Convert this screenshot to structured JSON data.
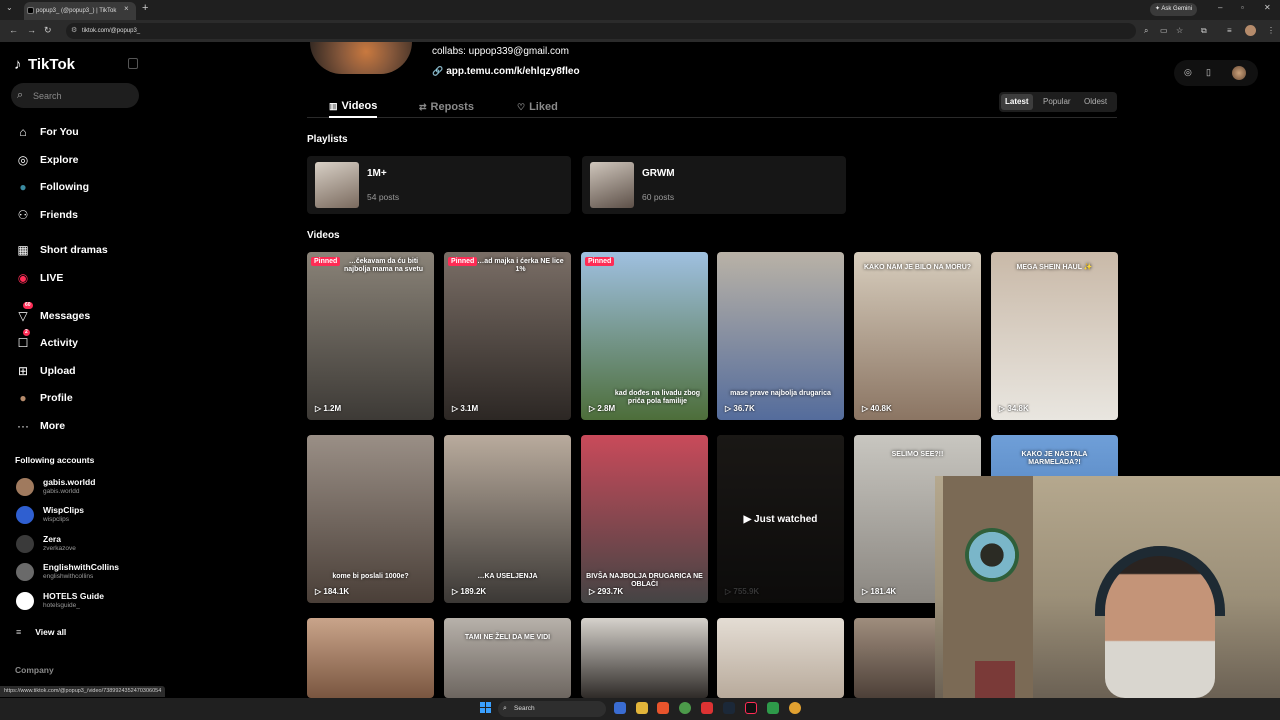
{
  "browser": {
    "tab_title": "popup3_ (@popup3_) | TikTok",
    "tab_close": "×",
    "new_tab": "+",
    "tabs_menu": "⌄",
    "url": "tiktok.com/@popup3_",
    "ask_gemini": "Ask Gemini",
    "status_url": "https://www.tiktok.com/@popup3_/video/7389924352470306054"
  },
  "sidebar": {
    "logo": "TikTok",
    "search_placeholder": "Search",
    "nav": [
      {
        "label": "For You",
        "icon": "home-icon"
      },
      {
        "label": "Explore",
        "icon": "compass-icon"
      },
      {
        "label": "Following",
        "icon": "following-avatar-icon"
      },
      {
        "label": "Friends",
        "icon": "friends-icon"
      },
      {
        "label": "Short dramas",
        "icon": "film-icon"
      },
      {
        "label": "LIVE",
        "icon": "live-icon"
      },
      {
        "label": "Messages",
        "icon": "messages-icon",
        "badge": "60"
      },
      {
        "label": "Activity",
        "icon": "activity-icon",
        "badge": "2"
      },
      {
        "label": "Upload",
        "icon": "upload-icon"
      },
      {
        "label": "Profile",
        "icon": "profile-avatar-icon"
      },
      {
        "label": "More",
        "icon": "more-icon"
      }
    ],
    "following_title": "Following accounts",
    "accounts": [
      {
        "name": "gabis.worldd",
        "handle": "gabis.worldd",
        "color": "#a07a5e"
      },
      {
        "name": "WispClips",
        "handle": "wispclips",
        "color": "#2f5fd0"
      },
      {
        "name": "Zera",
        "handle": "zverkazove",
        "color": "#3a3a3a"
      },
      {
        "name": "EnglishwithCollins",
        "handle": "englishwithcollins",
        "color": "#6a6a6a"
      },
      {
        "name": "HOTELS Guide",
        "handle": "hotelsguide_",
        "color": "#ffffff"
      }
    ],
    "view_all": "View all",
    "company": "Company"
  },
  "profile": {
    "collabs": "collabs: uppop339@gmail.com",
    "link": "app.temu.com/k/ehlqzy8fleo",
    "tabs": [
      {
        "label": "Videos",
        "active": true
      },
      {
        "label": "Reposts",
        "active": false
      },
      {
        "label": "Liked",
        "active": false
      }
    ],
    "sort": [
      "Latest",
      "Popular",
      "Oldest"
    ],
    "sort_selected": "Latest"
  },
  "playlists_heading": "Playlists",
  "playlists": [
    {
      "name": "1M+",
      "count": "54 posts"
    },
    {
      "name": "GRWM",
      "count": "60 posts"
    }
  ],
  "videos_heading": "Videos",
  "pinned_label": "Pinned",
  "just_watched": "Just watched",
  "videos": [
    {
      "views": "1.2M",
      "pinned": true,
      "caption": "…čekavam da ću biti najbolja mama na svetu",
      "colors": [
        "#8a8378",
        "#3d3a36"
      ]
    },
    {
      "views": "3.1M",
      "pinned": true,
      "caption": "…ad majka i ćerka NE lice 1%",
      "colors": [
        "#7a6e66",
        "#2c2724"
      ]
    },
    {
      "views": "2.8M",
      "pinned": true,
      "caption": "kad dođes na livadu zbog priča pola familije",
      "colors": [
        "#9fc0e0",
        "#4d6e3a"
      ]
    },
    {
      "views": "36.7K",
      "pinned": false,
      "caption": "mase prave najbolja drugarica",
      "colors": [
        "#b9b2a6",
        "#546c9c"
      ]
    },
    {
      "views": "40.8K",
      "pinned": false,
      "caption": "KAKO NAM JE BILO NA MORU?",
      "colors": [
        "#d7cdbd",
        "#8b7563"
      ]
    },
    {
      "views": "34.8K",
      "pinned": false,
      "caption": "MEGA SHEIN HAUL ✨",
      "colors": [
        "#c9b9a8",
        "#e9e6e0"
      ]
    },
    {
      "views": "184.1K",
      "pinned": false,
      "caption": "kome bi poslali 1000e?",
      "colors": [
        "#9a8f86",
        "#4a3f38"
      ]
    },
    {
      "views": "189.2K",
      "pinned": false,
      "caption": "…KA USELJENJA",
      "colors": [
        "#b9ab9d",
        "#3b3835"
      ]
    },
    {
      "views": "293.7K",
      "pinned": false,
      "caption": "BIVŠA NAJBOLJA DRUGARICA NE OBLAČI",
      "colors": [
        "#c94a5a",
        "#444"
      ]
    },
    {
      "views": "755.9K",
      "pinned": false,
      "caption": "",
      "colors": [
        "#3a3530",
        "#1c1a18"
      ],
      "just_watched": true
    },
    {
      "views": "181.4K",
      "pinned": false,
      "caption": "SELIMO SEE?!!",
      "colors": [
        "#c8c6c0",
        "#8a8680"
      ]
    },
    {
      "views": "",
      "pinned": false,
      "caption": "KAKO JE NASTALA MARMELADA?!",
      "colors": [
        "#6f9fd8",
        "#3b6aa8"
      ]
    },
    {
      "views": "",
      "pinned": false,
      "caption": "",
      "colors": [
        "#c9a48a",
        "#7a5640"
      ]
    },
    {
      "views": "",
      "pinned": false,
      "caption": "TAMI NE ŽELI DA ME VIDI",
      "colors": [
        "#b7b1aa",
        "#6d6660"
      ]
    },
    {
      "views": "",
      "pinned": false,
      "caption": "",
      "colors": [
        "#d6d2cc",
        "#2f2b28"
      ]
    },
    {
      "views": "",
      "pinned": false,
      "caption": "",
      "colors": [
        "#e4ddd4",
        "#b8aa9b"
      ]
    },
    {
      "views": "",
      "pinned": false,
      "caption": "",
      "colors": [
        "#9f8d7d",
        "#4d4038"
      ]
    }
  ],
  "taskbar": {
    "search_label": "Search"
  },
  "colors": {
    "accent": "#fe2c55",
    "bg": "#000000",
    "card": "#161616"
  }
}
